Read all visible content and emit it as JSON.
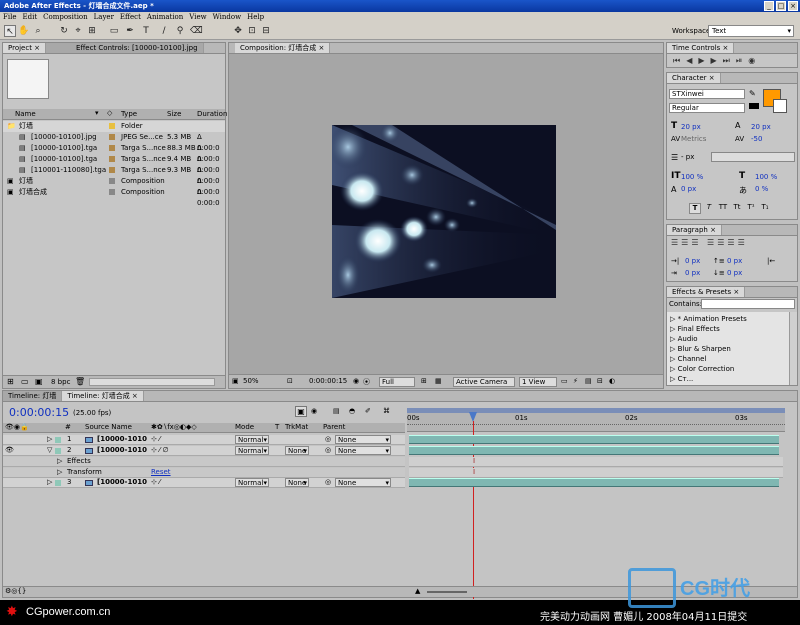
{
  "app": {
    "title": "Adobe After Effects - 灯墙合成文件.aep *"
  },
  "window_buttons": [
    "_",
    "□",
    "×"
  ],
  "menu": [
    "File",
    "Edit",
    "Composition",
    "Layer",
    "Effect",
    "Animation",
    "View",
    "Window",
    "Help"
  ],
  "workspace": {
    "label": "Workspace:",
    "value": "Text"
  },
  "project": {
    "tabs": [
      "Project ×",
      "Effect Controls: [10000-10100].jpg"
    ],
    "columns": [
      "Name",
      "Type",
      "Size",
      "Duration"
    ],
    "rows": [
      {
        "name": "灯墙",
        "type": "Folder",
        "size": "",
        "dur": "",
        "color": "#e8c040",
        "indent": 0
      },
      {
        "name": "[10000-10100].jpg",
        "type": "JPEG Se...ce",
        "size": "5.3 MB",
        "dur": "Δ 0:00:0",
        "color": "#b08848",
        "indent": 1
      },
      {
        "name": "[10000-10100].tga",
        "type": "Targa S...nce",
        "size": "88.3 MB",
        "dur": "Δ 0:00:0",
        "color": "#b08848",
        "indent": 1
      },
      {
        "name": "[10000-10100].tga",
        "type": "Targa S...nce",
        "size": "9.4 MB",
        "dur": "Δ 0:00:0",
        "color": "#b08848",
        "indent": 1
      },
      {
        "name": "[110001-110080].tga",
        "type": "Targa S...nce",
        "size": "9.3 MB",
        "dur": "Δ 0:00:0",
        "color": "#b08848",
        "indent": 1
      },
      {
        "name": "灯墙",
        "type": "Composition",
        "size": "",
        "dur": "Δ 0:00:0",
        "color": "#888888",
        "indent": 0
      },
      {
        "name": "灯墙合成",
        "type": "Composition",
        "size": "",
        "dur": "Δ 0:00:0",
        "color": "#888888",
        "indent": 0
      }
    ],
    "bpc": "8 bpc"
  },
  "composition": {
    "tab": "Composition: 灯墙合成 ×",
    "zoom": "50%",
    "timecode": "0:00:00:15",
    "resolution": "Full",
    "camera": "Active Camera",
    "view": "1 View"
  },
  "time_controls": {
    "tab": "Time Controls ×"
  },
  "character": {
    "tab": "Character ×",
    "font": "STXinwei",
    "style": "Regular",
    "font_size": "20 px",
    "leading": "20 px",
    "kerning_label": "Metrics",
    "tracking": "-50",
    "stroke_width": "- px",
    "v_scale": "100 %",
    "h_scale": "100 %",
    "baseline": "0 px",
    "tsume": "0 %",
    "fill_color": "#ff9900",
    "style_buttons": [
      "T",
      "T",
      "TT",
      "Tt",
      "T¹",
      "T₁"
    ]
  },
  "paragraph": {
    "tab": "Paragraph ×",
    "indent_left": "0 px",
    "indent_first": "0 px",
    "space_before": "0 px",
    "indent_right": "0 px",
    "space_after": "0 px"
  },
  "effects_presets": {
    "tab": "Effects & Presets ×",
    "contains_label": "Contains:",
    "items": [
      "* Animation Presets",
      "Final Effects",
      "Audio",
      "Blur & Sharpen",
      "Channel",
      "Color Correction",
      "Ст..."
    ]
  },
  "timeline": {
    "tabs": [
      "Timeline: 灯墙",
      "Timeline: 灯墙合成 ×"
    ],
    "timecode": "0:00:00:15",
    "fps": "(25.00 fps)",
    "columns": {
      "num": "#",
      "source": "Source Name",
      "mode": "Mode",
      "t": "T",
      "trkmat": "TrkMat",
      "parent": "Parent"
    },
    "ruler": [
      "00s",
      "01s",
      "02s",
      "03s"
    ],
    "layers": [
      {
        "num": "1",
        "name": "[10000-1010",
        "mode": "Normal",
        "trkmat": "",
        "parent": "None"
      },
      {
        "num": "2",
        "name": "[10000-1010",
        "mode": "Normal",
        "trkmat": "None",
        "parent": "None"
      },
      {
        "num": "3",
        "name": "[10000-1010",
        "mode": "Normal",
        "trkmat": "None",
        "parent": "None"
      }
    ],
    "sub_effects": "Effects",
    "sub_transform": "Transform",
    "reset": "Reset"
  },
  "footer": {
    "logo_text": "CGpower.com.cn",
    "caption": "完美动力动画网 曹媚儿 2008年04月11日提交",
    "watermark": "CG时代"
  }
}
